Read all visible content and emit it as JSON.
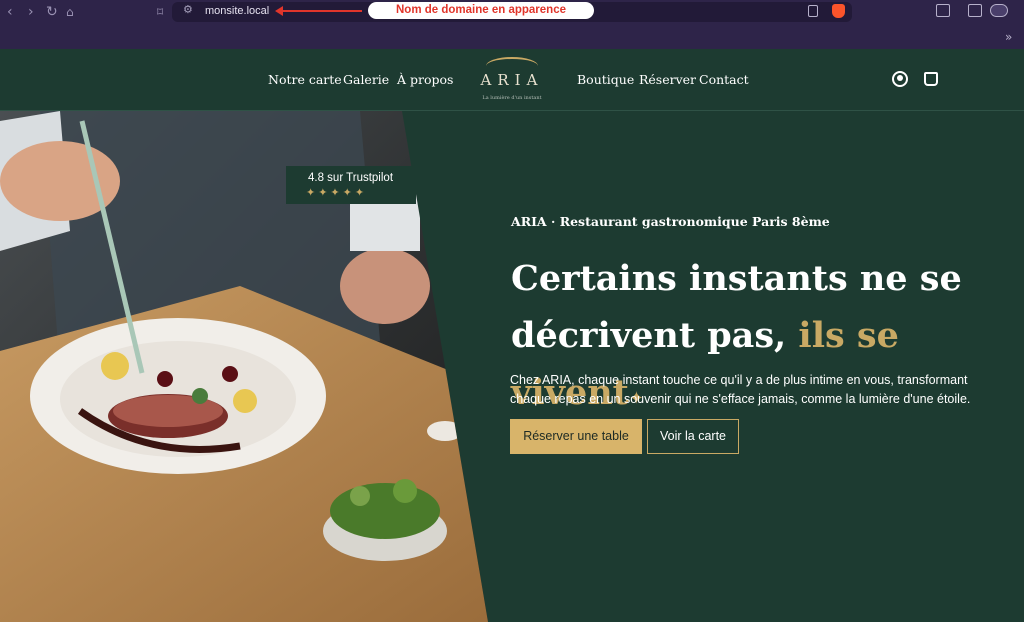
{
  "browser": {
    "url": "monsite.local",
    "annotation": "Nom de domaine en apparence"
  },
  "nav": {
    "left": [
      "Notre carte",
      "Galerie",
      "À propos"
    ],
    "right": [
      "Boutique",
      "Réserver",
      "Contact"
    ],
    "logo_text": "ARIA",
    "logo_tagline": "La lumière d'un instant"
  },
  "hero": {
    "rating": "4.8 sur Trustpilot",
    "stars": "✦✦✦✦✦",
    "kicker": "ARIA · Restaurant gastronomique Paris 8ème",
    "title_line1": "Certains instants ne se",
    "title_line2_start": "décrivent pas, ",
    "title_accent": "ils se vivent",
    "sparkle": "✦",
    "paragraph": "Chez ARIA, chaque instant touche ce qu'il y a de plus intime en vous, transformant chaque repas en un souvenir qui ne s'efface jamais, comme la lumière d'une étoile.",
    "cta_primary": "Réserver une table",
    "cta_secondary": "Voir la carte"
  },
  "colors": {
    "brand_green": "#1d3b31",
    "gold": "#c9a964",
    "browser_purple": "#2e2449"
  }
}
